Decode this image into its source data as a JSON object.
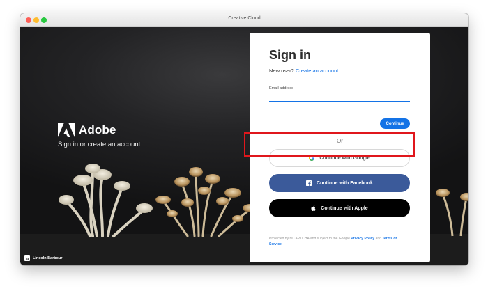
{
  "window": {
    "title": "Creative Cloud"
  },
  "brand": {
    "name": "Adobe",
    "tagline": "Sign in or create an account"
  },
  "photo_credit": {
    "badge": "St",
    "name": "Lincoln Barbour"
  },
  "signin": {
    "heading": "Sign in",
    "new_user_text": "New user?",
    "create_account_link": "Create an account",
    "email_label": "Email address",
    "email_value": "",
    "continue_label": "Continue",
    "or_label": "Or",
    "google_label": "Continue with Google",
    "facebook_label": "Continue with Facebook",
    "apple_label": "Continue with Apple",
    "legal_prefix": "Protected by reCAPTCHA and subject to the Google",
    "privacy_link": "Privacy Policy",
    "legal_and": "and",
    "terms_link": "Terms of Service"
  },
  "colors": {
    "accent": "#1473e6",
    "facebook": "#3b5a9a",
    "apple": "#000000",
    "highlight": "#e0171c"
  },
  "icons": [
    "adobe-logo-icon",
    "google-icon",
    "facebook-icon",
    "apple-icon"
  ]
}
